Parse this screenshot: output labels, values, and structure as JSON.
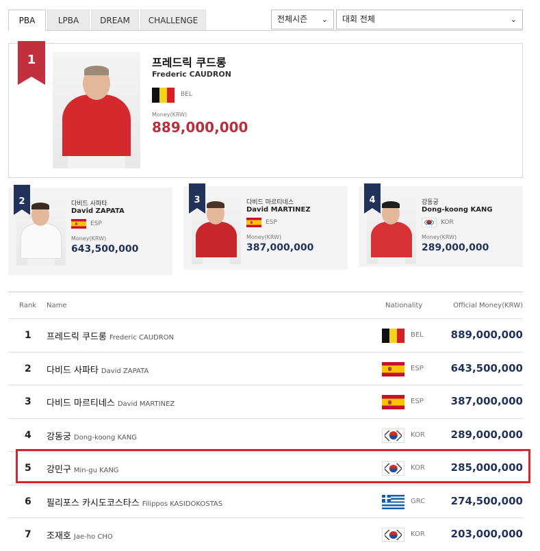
{
  "tabs": [
    {
      "label": "PBA",
      "active": true
    },
    {
      "label": "LPBA",
      "active": false
    },
    {
      "label": "DREAM",
      "active": false
    },
    {
      "label": "CHALLENGE",
      "active": false
    }
  ],
  "filters": {
    "season": "전체시즌",
    "tournament": "대회 전체"
  },
  "top": {
    "rank": "1",
    "name_ko": "프레드릭 쿠드롱",
    "name_en": "Frederic CAUDRON",
    "nat": "BEL",
    "money_label": "Money(KRW)",
    "money": "889,000,000"
  },
  "podium": [
    {
      "rank": "2",
      "name_ko": "다비드 사파타",
      "name_en": "David ZAPATA",
      "nat": "ESP",
      "money_label": "Money(KRW)",
      "money": "643,500,000"
    },
    {
      "rank": "3",
      "name_ko": "다비드 마르티네스",
      "name_en": "David MARTINEZ",
      "nat": "ESP",
      "money_label": "Money(KRW)",
      "money": "387,000,000"
    },
    {
      "rank": "4",
      "name_ko": "강동궁",
      "name_en": "Dong-koong KANG",
      "nat": "KOR",
      "money_label": "Money(KRW)",
      "money": "289,000,000"
    }
  ],
  "table": {
    "headers": {
      "rank": "Rank",
      "name": "Name",
      "nationality": "Nationality",
      "money": "Official Money(KRW)"
    },
    "rows": [
      {
        "rank": "1",
        "name_ko": "프레드릭 쿠드롱",
        "name_en": "Frederic CAUDRON",
        "nat": "BEL",
        "money": "889,000,000"
      },
      {
        "rank": "2",
        "name_ko": "다비드 사파타",
        "name_en": "David ZAPATA",
        "nat": "ESP",
        "money": "643,500,000"
      },
      {
        "rank": "3",
        "name_ko": "다비드 마르티네스",
        "name_en": "David MARTINEZ",
        "nat": "ESP",
        "money": "387,000,000"
      },
      {
        "rank": "4",
        "name_ko": "강동궁",
        "name_en": "Dong-koong KANG",
        "nat": "KOR",
        "money": "289,000,000"
      },
      {
        "rank": "5",
        "name_ko": "강민구",
        "name_en": "Min-gu KANG",
        "nat": "KOR",
        "money": "285,000,000"
      },
      {
        "rank": "6",
        "name_ko": "필리포스 카시도코스타스",
        "name_en": "Filippos KASIDOKOSTAS",
        "nat": "GRC",
        "money": "274,500,000"
      },
      {
        "rank": "7",
        "name_ko": "조재호",
        "name_en": "Jae-ho CHO",
        "nat": "KOR",
        "money": "203,000,000"
      }
    ]
  },
  "colors": {
    "accent_red": "#c0303f",
    "navy": "#22335a",
    "highlight": "#d9232d"
  }
}
